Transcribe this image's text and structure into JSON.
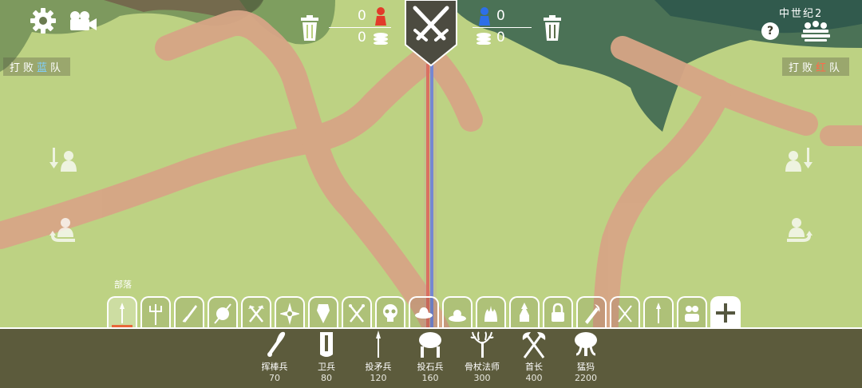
{
  "hud": {
    "settings_icon": "gear-icon",
    "camera_icon": "camera-icon",
    "era_name": "中世纪2",
    "help_label": "?",
    "red_units": "0",
    "red_cost": "0",
    "blue_units": "0",
    "blue_cost": "0",
    "defeat_blue_prefix": "打败",
    "defeat_blue_color": "蓝",
    "defeat_blue_suffix": "队",
    "defeat_red_prefix": "打败",
    "defeat_red_color": "红",
    "defeat_red_suffix": "队"
  },
  "tribe": {
    "label": "部落",
    "tabs": [
      "tribal-icon",
      "farmer-icon",
      "medieval-icon",
      "ancient-icon",
      "viking-icon",
      "dynasty-icon",
      "renaissance-icon",
      "pirate-icon",
      "spooky-icon",
      "wild-west-icon",
      "good-icon",
      "evil-icon",
      "secret-icon",
      "locked-icon",
      "legacy-icon",
      "custom-icon",
      "faction-icon",
      "custom-units-icon",
      "add-icon"
    ],
    "active_index": 0
  },
  "units": [
    {
      "name": "挥棒兵",
      "cost": "70",
      "icon": "club-icon"
    },
    {
      "name": "卫兵",
      "cost": "80",
      "icon": "shield-icon"
    },
    {
      "name": "投矛兵",
      "cost": "120",
      "icon": "spear-icon"
    },
    {
      "name": "投石兵",
      "cost": "160",
      "icon": "rock-thrower-icon"
    },
    {
      "name": "骨杖法师",
      "cost": "300",
      "icon": "antler-staff-icon"
    },
    {
      "name": "首长",
      "cost": "400",
      "icon": "crossed-axes-icon"
    },
    {
      "name": "猛犸",
      "cost": "2200",
      "icon": "mammoth-icon"
    }
  ],
  "colors": {
    "grass": "#b9cf7f",
    "path": "#d8a585",
    "blue_line": "#5a7fe0",
    "red_line": "#e0604a",
    "panel": "#5c5b3c",
    "accent": "#e8673a"
  }
}
